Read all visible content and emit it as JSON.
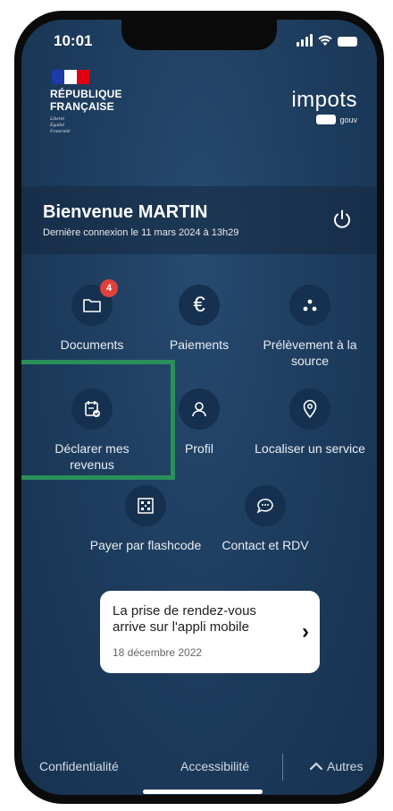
{
  "status_bar": {
    "time": "10:01"
  },
  "header": {
    "rf_line1": "RÉPUBLIQUE",
    "rf_line2": "FRANÇAISE",
    "rf_motto": [
      "Liberté",
      "Égalité",
      "Fraternité"
    ],
    "logo_text": "impots",
    "logo_sub": "gouv"
  },
  "welcome": {
    "title": "Bienvenue MARTIN",
    "last_login": "Dernière connexion le 11 mars 2024 à 13h29"
  },
  "tiles": {
    "documents": {
      "label": "Documents",
      "badge": "4"
    },
    "paiements": {
      "label": "Paiements",
      "glyph": "€"
    },
    "prelevement": {
      "label": "Prélèvement à la source"
    },
    "declarer": {
      "label": "Déclarer mes revenus"
    },
    "profil": {
      "label": "Profil"
    },
    "localiser": {
      "label": "Localiser un service"
    },
    "flashcode": {
      "label": "Payer par flashcode"
    },
    "contact": {
      "label": "Contact et RDV"
    }
  },
  "banner": {
    "title": "La prise de rendez-vous arrive sur l'appli mobile",
    "date": "18 décembre 2022",
    "chevron": "›"
  },
  "footer": {
    "confidentialite": "Confidentialité",
    "accessibilite": "Accessibilité",
    "autres": "Autres"
  },
  "colors": {
    "background": "#1d3b5c",
    "tile_circle": "#15314f",
    "badge": "#e0403a",
    "highlight_frame": "#2a8f5a",
    "flag_blue": "#1d3aa8",
    "flag_red": "#e1000f"
  },
  "icons": [
    "folder-icon",
    "euro-icon",
    "three-dots-icon",
    "declaration-icon",
    "user-icon",
    "location-pin-icon",
    "qr-code-icon",
    "chat-icon",
    "power-icon",
    "chevron-up-icon",
    "chevron-right-icon"
  ]
}
